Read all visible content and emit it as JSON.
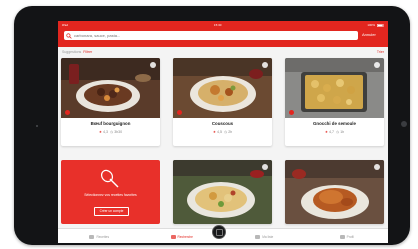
{
  "status_bar": {
    "carrier": "iPad",
    "time": "15:30",
    "battery": "100%"
  },
  "search": {
    "value": "",
    "placeholder": "carbonara, sauce, pasta...",
    "cancel_label": "Annuler"
  },
  "filters": {
    "results_label": "Suggestions",
    "filter_label": "Filtrer",
    "sort_label": "Trier"
  },
  "recipes": [
    {
      "name": "Bœuf bourguignon",
      "rating": "4,3",
      "time": "3h30"
    },
    {
      "name": "Couscous",
      "rating": "4,5",
      "time": "2h"
    },
    {
      "name": "Gnocchi de semoule",
      "rating": "4,7",
      "time": "1h"
    }
  ],
  "promo": {
    "text": "Sélectionnez vos recettes favorites",
    "button": "Créer un compte"
  },
  "tabs": [
    {
      "label": "Recettes",
      "active": false
    },
    {
      "label": "Recherche",
      "active": true
    },
    {
      "label": "Ma liste",
      "active": false
    },
    {
      "label": "Profil",
      "active": false
    }
  ],
  "colors": {
    "accent": "#e2261f",
    "device": "#131416"
  }
}
